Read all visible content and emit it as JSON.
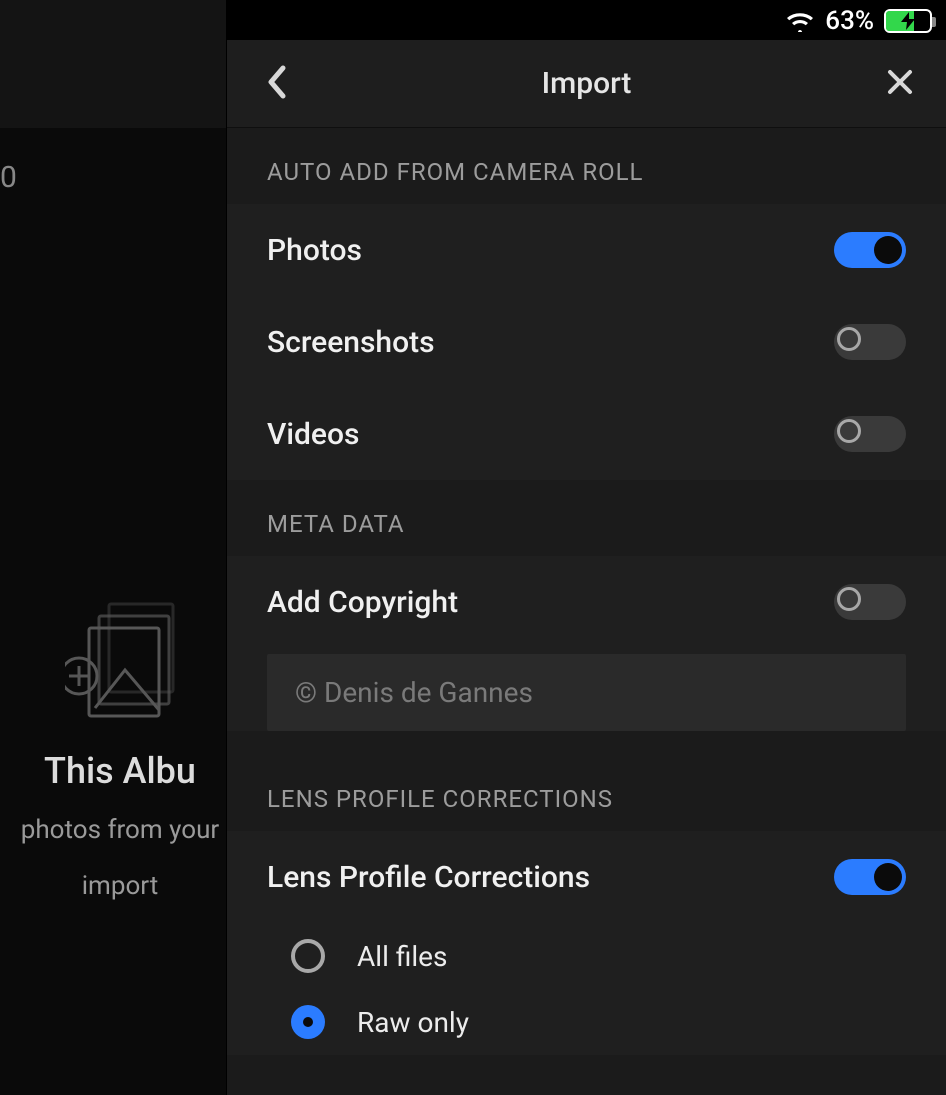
{
  "statusbar": {
    "battery_text": "63%",
    "battery_fill_pct": 63,
    "charging": true
  },
  "background": {
    "trailing_number": "0",
    "album_title": "This Albu",
    "album_sub_line1": "photos from your",
    "album_sub_line2": "import"
  },
  "panel": {
    "title": "Import"
  },
  "sections": {
    "auto_add": {
      "header": "AUTO ADD FROM CAMERA ROLL",
      "items": [
        {
          "label": "Photos",
          "on": true
        },
        {
          "label": "Screenshots",
          "on": false
        },
        {
          "label": "Videos",
          "on": false
        }
      ]
    },
    "metadata": {
      "header": "META DATA",
      "add_copyright_label": "Add Copyright",
      "add_copyright_on": false,
      "copyright_value": "© Denis de Gannes"
    },
    "lens": {
      "header": "LENS PROFILE CORRECTIONS",
      "toggle_label": "Lens Profile Corrections",
      "toggle_on": true,
      "options": [
        {
          "label": "All files",
          "selected": false
        },
        {
          "label": "Raw only",
          "selected": true
        }
      ]
    }
  }
}
